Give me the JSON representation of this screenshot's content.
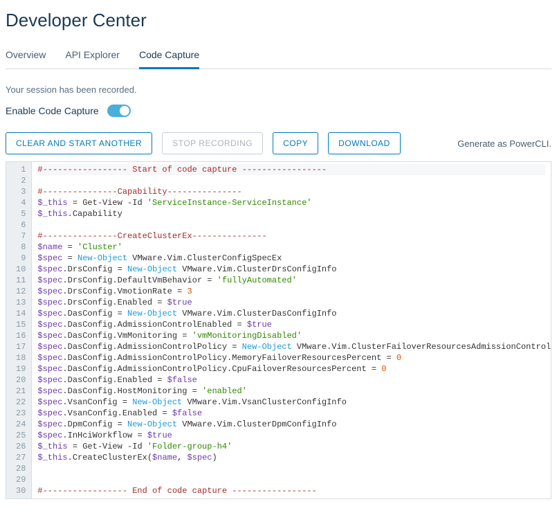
{
  "page_title": "Developer Center",
  "tabs": [
    {
      "label": "Overview",
      "active": false
    },
    {
      "label": "API Explorer",
      "active": false
    },
    {
      "label": "Code Capture",
      "active": true
    }
  ],
  "status_text": "Your session has been recorded.",
  "toggle_label": "Enable Code Capture",
  "toggle_on": true,
  "buttons": {
    "clear": "CLEAR AND START ANOTHER",
    "stop": "STOP RECORDING",
    "copy": "COPY",
    "download": "DOWNLOAD"
  },
  "generate_label": "Generate as PowerCLI.",
  "code": [
    {
      "t": "comment",
      "s": "#----------------- Start of code capture -----------------"
    },
    {
      "t": "blank",
      "s": ""
    },
    {
      "t": "comment",
      "s": "#---------------Capability---------------"
    },
    {
      "t": "mixed",
      "parts": [
        [
          "var",
          "$_this"
        ],
        [
          "plain",
          " = Get-View -Id "
        ],
        [
          "str",
          "'ServiceInstance-ServiceInstance'"
        ]
      ]
    },
    {
      "t": "mixed",
      "parts": [
        [
          "var",
          "$_this"
        ],
        [
          "plain",
          ".Capability"
        ]
      ]
    },
    {
      "t": "blank",
      "s": ""
    },
    {
      "t": "comment",
      "s": "#---------------CreateClusterEx---------------"
    },
    {
      "t": "mixed",
      "parts": [
        [
          "var",
          "$name"
        ],
        [
          "plain",
          " = "
        ],
        [
          "str",
          "'Cluster'"
        ]
      ]
    },
    {
      "t": "mixed",
      "parts": [
        [
          "var",
          "$spec"
        ],
        [
          "plain",
          " = "
        ],
        [
          "kw",
          "New-Object"
        ],
        [
          "plain",
          " VMware.Vim.ClusterConfigSpecEx"
        ]
      ]
    },
    {
      "t": "mixed",
      "parts": [
        [
          "var",
          "$spec"
        ],
        [
          "plain",
          ".DrsConfig = "
        ],
        [
          "kw",
          "New-Object"
        ],
        [
          "plain",
          " VMware.Vim.ClusterDrsConfigInfo"
        ]
      ]
    },
    {
      "t": "mixed",
      "parts": [
        [
          "var",
          "$spec"
        ],
        [
          "plain",
          ".DrsConfig.DefaultVmBehavior = "
        ],
        [
          "str",
          "'fullyAutomated'"
        ]
      ]
    },
    {
      "t": "mixed",
      "parts": [
        [
          "var",
          "$spec"
        ],
        [
          "plain",
          ".DrsConfig.VmotionRate = "
        ],
        [
          "num",
          "3"
        ]
      ]
    },
    {
      "t": "mixed",
      "parts": [
        [
          "var",
          "$spec"
        ],
        [
          "plain",
          ".DrsConfig.Enabled = "
        ],
        [
          "var",
          "$true"
        ]
      ]
    },
    {
      "t": "mixed",
      "parts": [
        [
          "var",
          "$spec"
        ],
        [
          "plain",
          ".DasConfig = "
        ],
        [
          "kw",
          "New-Object"
        ],
        [
          "plain",
          " VMware.Vim.ClusterDasConfigInfo"
        ]
      ]
    },
    {
      "t": "mixed",
      "parts": [
        [
          "var",
          "$spec"
        ],
        [
          "plain",
          ".DasConfig.AdmissionControlEnabled = "
        ],
        [
          "var",
          "$true"
        ]
      ]
    },
    {
      "t": "mixed",
      "parts": [
        [
          "var",
          "$spec"
        ],
        [
          "plain",
          ".DasConfig.VmMonitoring = "
        ],
        [
          "str",
          "'vmMonitoringDisabled'"
        ]
      ]
    },
    {
      "t": "mixed",
      "parts": [
        [
          "var",
          "$spec"
        ],
        [
          "plain",
          ".DasConfig.AdmissionControlPolicy = "
        ],
        [
          "kw",
          "New-Object"
        ],
        [
          "plain",
          " VMware.Vim.ClusterFailoverResourcesAdmissionControlPolicy"
        ]
      ]
    },
    {
      "t": "mixed",
      "parts": [
        [
          "var",
          "$spec"
        ],
        [
          "plain",
          ".DasConfig.AdmissionControlPolicy.MemoryFailoverResourcesPercent = "
        ],
        [
          "num",
          "0"
        ]
      ]
    },
    {
      "t": "mixed",
      "parts": [
        [
          "var",
          "$spec"
        ],
        [
          "plain",
          ".DasConfig.AdmissionControlPolicy.CpuFailoverResourcesPercent = "
        ],
        [
          "num",
          "0"
        ]
      ]
    },
    {
      "t": "mixed",
      "parts": [
        [
          "var",
          "$spec"
        ],
        [
          "plain",
          ".DasConfig.Enabled = "
        ],
        [
          "var",
          "$false"
        ]
      ]
    },
    {
      "t": "mixed",
      "parts": [
        [
          "var",
          "$spec"
        ],
        [
          "plain",
          ".DasConfig.HostMonitoring = "
        ],
        [
          "str",
          "'enabled'"
        ]
      ]
    },
    {
      "t": "mixed",
      "parts": [
        [
          "var",
          "$spec"
        ],
        [
          "plain",
          ".VsanConfig = "
        ],
        [
          "kw",
          "New-Object"
        ],
        [
          "plain",
          " VMware.Vim.VsanClusterConfigInfo"
        ]
      ]
    },
    {
      "t": "mixed",
      "parts": [
        [
          "var",
          "$spec"
        ],
        [
          "plain",
          ".VsanConfig.Enabled = "
        ],
        [
          "var",
          "$false"
        ]
      ]
    },
    {
      "t": "mixed",
      "parts": [
        [
          "var",
          "$spec"
        ],
        [
          "plain",
          ".DpmConfig = "
        ],
        [
          "kw",
          "New-Object"
        ],
        [
          "plain",
          " VMware.Vim.ClusterDpmConfigInfo"
        ]
      ]
    },
    {
      "t": "mixed",
      "parts": [
        [
          "var",
          "$spec"
        ],
        [
          "plain",
          ".InHciWorkflow = "
        ],
        [
          "var",
          "$true"
        ]
      ]
    },
    {
      "t": "mixed",
      "parts": [
        [
          "var",
          "$_this"
        ],
        [
          "plain",
          " = Get-View -Id "
        ],
        [
          "str",
          "'Folder-group-h4'"
        ]
      ]
    },
    {
      "t": "mixed",
      "parts": [
        [
          "var",
          "$_this"
        ],
        [
          "plain",
          ".CreateClusterEx("
        ],
        [
          "var",
          "$name"
        ],
        [
          "plain",
          ", "
        ],
        [
          "var",
          "$spec"
        ],
        [
          "plain",
          ")"
        ]
      ]
    },
    {
      "t": "blank",
      "s": ""
    },
    {
      "t": "blank",
      "s": ""
    },
    {
      "t": "comment",
      "s": "#----------------- End of code capture -----------------"
    }
  ]
}
